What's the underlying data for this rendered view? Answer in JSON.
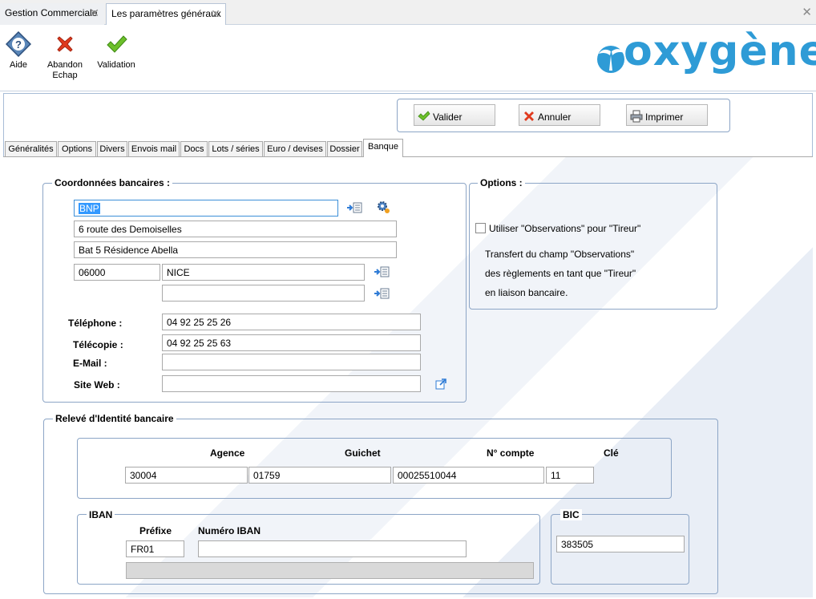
{
  "doc_tabs": [
    {
      "label": "Gestion Commerciale"
    },
    {
      "label": "Les paramètres généraux"
    }
  ],
  "ribbon": {
    "help": "Aide",
    "cancel_line1": "Abandon",
    "cancel_line2": "Echap",
    "validate": "Validation"
  },
  "logo": {
    "text": "oxygène"
  },
  "actions": {
    "validate": "Valider",
    "cancel": "Annuler",
    "print": "Imprimer"
  },
  "tabs": [
    "Généralités",
    "Options",
    "Divers",
    "Envois mail",
    "Docs",
    "Lots / séries",
    "Euro / devises",
    "Dossier",
    "Banque"
  ],
  "bank": {
    "legend": "Coordonnées bancaires :",
    "name": "BNP",
    "address1": "6 route des Demoiselles",
    "address2": "Bat 5 Résidence Abella",
    "postal_code": "06000",
    "city": "NICE",
    "city2": "",
    "phone_label": "Téléphone :",
    "phone": "04 92 25 25 26",
    "fax_label": "Télécopie :",
    "fax": "04 92 25 25 63",
    "email_label": "E-Mail :",
    "email": "",
    "website_label": "Site Web :",
    "website": ""
  },
  "options": {
    "legend": "Options :",
    "checkbox_label": "Utiliser \"Observations\" pour \"Tireur\"",
    "checked": false,
    "desc1": "Transfert du champ \"Observations\"",
    "desc2": "des règlements en tant que \"Tireur\"",
    "desc3": "en liaison bancaire."
  },
  "rib": {
    "legend": "Relevé d'Identité bancaire",
    "agency_label": "Agence",
    "agency": "30004",
    "counter_label": "Guichet",
    "counter": "01759",
    "account_label": "N° compte",
    "account": "00025510044",
    "key_label": "Clé",
    "key": "11"
  },
  "iban": {
    "legend": "IBAN",
    "prefix_label": "Préfixe",
    "prefix": "FR01",
    "number_label": "Numéro IBAN",
    "number": "",
    "full": ""
  },
  "bic": {
    "legend": "BIC",
    "value": "383505"
  },
  "colors": {
    "accent": "#2e9bd6",
    "border": "#8ca5c6",
    "selection": "#3399ff"
  }
}
